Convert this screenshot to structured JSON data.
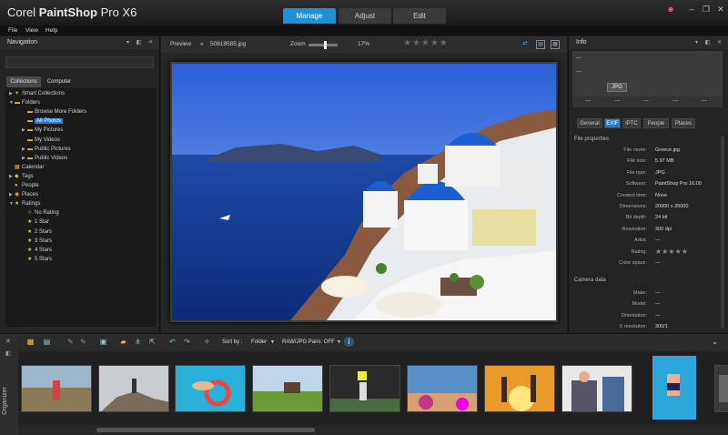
{
  "app": {
    "brand_a": "Corel ",
    "brand_b": "PaintShop",
    "brand_c": " Pro X6"
  },
  "modes": [
    {
      "label": "Manage",
      "active": true
    },
    {
      "label": "Adjust",
      "active": false
    },
    {
      "label": "Edit",
      "active": false
    }
  ],
  "menu": [
    "File",
    "View",
    "Help"
  ],
  "navigation": {
    "title": "Navigation",
    "tabs": [
      {
        "label": "Collections"
      },
      {
        "label": "Computer"
      }
    ],
    "tree": [
      {
        "label": "Smart Collections",
        "level": 0,
        "icon": "smart-icon",
        "arrow": "▶"
      },
      {
        "label": "Folders",
        "level": 0,
        "icon": "folder-icon",
        "arrow": "▼"
      },
      {
        "label": "Browse More Folders",
        "level": 1,
        "icon": "folder-icon",
        "arrow": ""
      },
      {
        "label": "All Photos",
        "level": 1,
        "icon": "folder-icon",
        "arrow": "",
        "selected": true
      },
      {
        "label": "My Pictures",
        "level": 1,
        "icon": "folder-icon",
        "arrow": "▶"
      },
      {
        "label": "My Videos",
        "level": 1,
        "icon": "folder-icon",
        "arrow": ""
      },
      {
        "label": "Public Pictures",
        "level": 1,
        "icon": "folder-icon",
        "arrow": "▶"
      },
      {
        "label": "Public Videos",
        "level": 1,
        "icon": "folder-icon",
        "arrow": "▶"
      },
      {
        "label": "Calendar",
        "level": 0,
        "icon": "calendar-icon",
        "arrow": ""
      },
      {
        "label": "Tags",
        "level": 0,
        "icon": "tag-icon",
        "arrow": "▶"
      },
      {
        "label": "People",
        "level": 0,
        "icon": "person-icon",
        "arrow": ""
      },
      {
        "label": "Places",
        "level": 0,
        "icon": "pin-icon",
        "arrow": "▶"
      },
      {
        "label": "Ratings",
        "level": 0,
        "icon": "star-icon",
        "arrow": "▼"
      },
      {
        "label": "No Rating",
        "level": 1,
        "icon": "star-empty-icon",
        "arrow": ""
      },
      {
        "label": "1 Star",
        "level": 1,
        "icon": "star-icon",
        "arrow": ""
      },
      {
        "label": "2 Stars",
        "level": 1,
        "icon": "star-icon",
        "arrow": ""
      },
      {
        "label": "3 Stars",
        "level": 1,
        "icon": "star-icon",
        "arrow": ""
      },
      {
        "label": "4 Stars",
        "level": 1,
        "icon": "star-icon",
        "arrow": ""
      },
      {
        "label": "5 Stars",
        "level": 1,
        "icon": "star-icon",
        "arrow": ""
      }
    ]
  },
  "preview": {
    "label": "Preview",
    "breadcrumb_sep": "»",
    "filename": "50819585.jpg",
    "zoom_label": "Zoom",
    "zoom_value": "17%",
    "zoom_fraction": 0.17,
    "rating_stars": "★★★★★"
  },
  "info": {
    "title": "Info",
    "thumb_dash1": "---",
    "thumb_dash2": "---",
    "badge": "JPG",
    "thumb_row": [
      "---",
      "---",
      "---",
      "---",
      "---"
    ],
    "tabs": [
      {
        "label": "General",
        "active": false
      },
      {
        "label": "EXIF",
        "active": true
      },
      {
        "label": "IPTC",
        "active": false
      },
      {
        "label": "People",
        "active": false
      },
      {
        "label": "Places",
        "active": false
      }
    ],
    "file_section": "File properties",
    "props": [
      {
        "label": "File name:",
        "value": "Greece.jpg"
      },
      {
        "label": "File size:",
        "value": "5.97 MB"
      },
      {
        "label": "File type:",
        "value": "JPG"
      },
      {
        "label": "Software:",
        "value": "PaintShop Pro 16.00"
      },
      {
        "label": "Created time:",
        "value": "None"
      },
      {
        "label": "Dimensions:",
        "value": "20000 x 20000"
      },
      {
        "label": "Bit depth:",
        "value": "24 bit"
      },
      {
        "label": "Resolution:",
        "value": "300 dpi"
      },
      {
        "label": "Artist:",
        "value": "---"
      },
      {
        "label": "Rating:",
        "value": "★★★★★"
      },
      {
        "label": "Color space:",
        "value": "---"
      }
    ],
    "camera_section": "Camera data",
    "camera_props": [
      {
        "label": "Make:",
        "value": "---"
      },
      {
        "label": "Model:",
        "value": "---"
      },
      {
        "label": "Orientation:",
        "value": "---"
      },
      {
        "label": "X resolution:",
        "value": "300/1"
      }
    ]
  },
  "organizer": {
    "label": "Organizer",
    "sort_label": "Sort by :",
    "sort_value": "Folder",
    "raw_label": "RAW/JPG Pairs: OFF",
    "thumbs": [
      {
        "id": "child-field"
      },
      {
        "id": "rock-climber"
      },
      {
        "id": "pool-float"
      },
      {
        "id": "horse-field"
      },
      {
        "id": "kids-play"
      },
      {
        "id": "village-coast"
      },
      {
        "id": "sunset-jump"
      },
      {
        "id": "family-sofa"
      },
      {
        "id": "pool-dive",
        "selected": true
      },
      {
        "id": "dark-partial"
      }
    ]
  },
  "colors": {
    "accent": "#1e90d6",
    "selection": "#1e7fd0",
    "panel": "#232323",
    "star": "#e6c23c"
  }
}
